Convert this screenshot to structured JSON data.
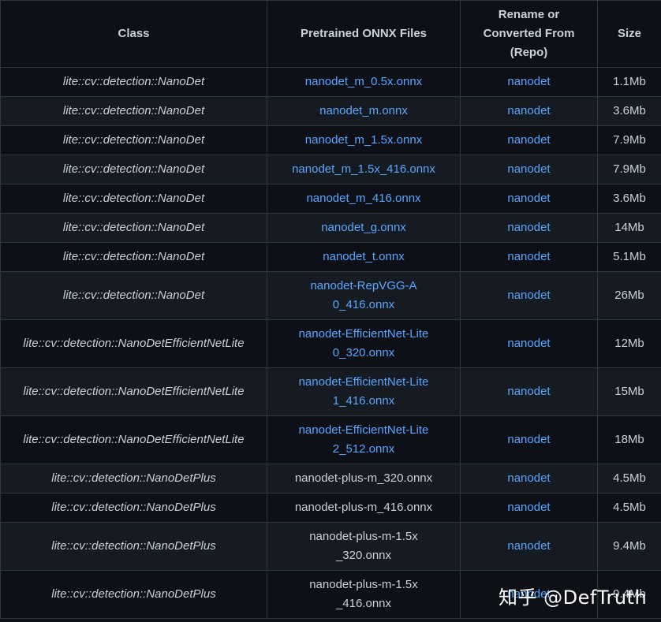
{
  "table": {
    "headers": [
      "Class",
      "Pretrained ONNX Files",
      "Rename or Converted From (Repo)",
      "Size"
    ],
    "rows": [
      {
        "cls": "lite::cv::detection::NanoDet",
        "file": "nanodet_m_0.5x.onnx",
        "file_link": true,
        "repo": "nanodet",
        "size": "1.1Mb"
      },
      {
        "cls": "lite::cv::detection::NanoDet",
        "file": "nanodet_m.onnx",
        "file_link": true,
        "repo": "nanodet",
        "size": "3.6Mb"
      },
      {
        "cls": "lite::cv::detection::NanoDet",
        "file": "nanodet_m_1.5x.onnx",
        "file_link": true,
        "repo": "nanodet",
        "size": "7.9Mb"
      },
      {
        "cls": "lite::cv::detection::NanoDet",
        "file": "nanodet_m_1.5x_416.onnx",
        "file_link": true,
        "repo": "nanodet",
        "size": "7.9Mb"
      },
      {
        "cls": "lite::cv::detection::NanoDet",
        "file": "nanodet_m_416.onnx",
        "file_link": true,
        "repo": "nanodet",
        "size": "3.6Mb"
      },
      {
        "cls": "lite::cv::detection::NanoDet",
        "file": "nanodet_g.onnx",
        "file_link": true,
        "repo": "nanodet",
        "size": "14Mb"
      },
      {
        "cls": "lite::cv::detection::NanoDet",
        "file": "nanodet_t.onnx",
        "file_link": true,
        "repo": "nanodet",
        "size": "5.1Mb"
      },
      {
        "cls": "lite::cv::detection::NanoDet",
        "file": "nanodet-RepVGG-A0_416.onnx",
        "file_link": true,
        "repo": "nanodet",
        "size": "26Mb"
      },
      {
        "cls": "lite::cv::detection::NanoDetEfficientNetLite",
        "file": "nanodet-EfficientNet-Lite0_320.onnx",
        "file_link": true,
        "repo": "nanodet",
        "size": "12Mb"
      },
      {
        "cls": "lite::cv::detection::NanoDetEfficientNetLite",
        "file": "nanodet-EfficientNet-Lite1_416.onnx",
        "file_link": true,
        "repo": "nanodet",
        "size": "15Mb"
      },
      {
        "cls": "lite::cv::detection::NanoDetEfficientNetLite",
        "file": "nanodet-EfficientNet-Lite2_512.onnx",
        "file_link": true,
        "repo": "nanodet",
        "size": "18Mb"
      },
      {
        "cls": "lite::cv::detection::NanoDetPlus",
        "file": "nanodet-plus-m_320.onnx",
        "file_link": false,
        "repo": "nanodet",
        "size": "4.5Mb"
      },
      {
        "cls": "lite::cv::detection::NanoDetPlus",
        "file": "nanodet-plus-m_416.onnx",
        "file_link": false,
        "repo": "nanodet",
        "size": "4.5Mb"
      },
      {
        "cls": "lite::cv::detection::NanoDetPlus",
        "file": "nanodet-plus-m-1.5x_320.onnx",
        "file_link": false,
        "repo": "nanodet",
        "size": "9.4Mb"
      },
      {
        "cls": "lite::cv::detection::NanoDetPlus",
        "file": "nanodet-plus-m-1.5x_416.onnx",
        "file_link": false,
        "repo": "nanodet",
        "size": "9.4Mb"
      }
    ]
  },
  "watermark": "知乎 @DefTruth",
  "colors": {
    "background": "#0d1117",
    "row_alt": "#161b22",
    "border": "#30363d",
    "text": "#c9d1d9",
    "link": "#58a6ff"
  }
}
